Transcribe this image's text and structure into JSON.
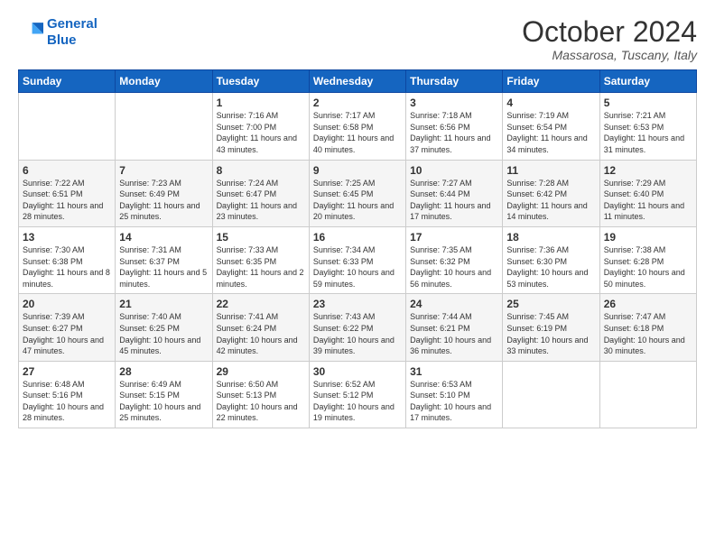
{
  "logo": {
    "line1": "General",
    "line2": "Blue"
  },
  "title": "October 2024",
  "location": "Massarosa, Tuscany, Italy",
  "weekdays": [
    "Sunday",
    "Monday",
    "Tuesday",
    "Wednesday",
    "Thursday",
    "Friday",
    "Saturday"
  ],
  "weeks": [
    [
      {
        "day": "",
        "info": ""
      },
      {
        "day": "",
        "info": ""
      },
      {
        "day": "1",
        "info": "Sunrise: 7:16 AM\nSunset: 7:00 PM\nDaylight: 11 hours and 43 minutes."
      },
      {
        "day": "2",
        "info": "Sunrise: 7:17 AM\nSunset: 6:58 PM\nDaylight: 11 hours and 40 minutes."
      },
      {
        "day": "3",
        "info": "Sunrise: 7:18 AM\nSunset: 6:56 PM\nDaylight: 11 hours and 37 minutes."
      },
      {
        "day": "4",
        "info": "Sunrise: 7:19 AM\nSunset: 6:54 PM\nDaylight: 11 hours and 34 minutes."
      },
      {
        "day": "5",
        "info": "Sunrise: 7:21 AM\nSunset: 6:53 PM\nDaylight: 11 hours and 31 minutes."
      }
    ],
    [
      {
        "day": "6",
        "info": "Sunrise: 7:22 AM\nSunset: 6:51 PM\nDaylight: 11 hours and 28 minutes."
      },
      {
        "day": "7",
        "info": "Sunrise: 7:23 AM\nSunset: 6:49 PM\nDaylight: 11 hours and 25 minutes."
      },
      {
        "day": "8",
        "info": "Sunrise: 7:24 AM\nSunset: 6:47 PM\nDaylight: 11 hours and 23 minutes."
      },
      {
        "day": "9",
        "info": "Sunrise: 7:25 AM\nSunset: 6:45 PM\nDaylight: 11 hours and 20 minutes."
      },
      {
        "day": "10",
        "info": "Sunrise: 7:27 AM\nSunset: 6:44 PM\nDaylight: 11 hours and 17 minutes."
      },
      {
        "day": "11",
        "info": "Sunrise: 7:28 AM\nSunset: 6:42 PM\nDaylight: 11 hours and 14 minutes."
      },
      {
        "day": "12",
        "info": "Sunrise: 7:29 AM\nSunset: 6:40 PM\nDaylight: 11 hours and 11 minutes."
      }
    ],
    [
      {
        "day": "13",
        "info": "Sunrise: 7:30 AM\nSunset: 6:38 PM\nDaylight: 11 hours and 8 minutes."
      },
      {
        "day": "14",
        "info": "Sunrise: 7:31 AM\nSunset: 6:37 PM\nDaylight: 11 hours and 5 minutes."
      },
      {
        "day": "15",
        "info": "Sunrise: 7:33 AM\nSunset: 6:35 PM\nDaylight: 11 hours and 2 minutes."
      },
      {
        "day": "16",
        "info": "Sunrise: 7:34 AM\nSunset: 6:33 PM\nDaylight: 10 hours and 59 minutes."
      },
      {
        "day": "17",
        "info": "Sunrise: 7:35 AM\nSunset: 6:32 PM\nDaylight: 10 hours and 56 minutes."
      },
      {
        "day": "18",
        "info": "Sunrise: 7:36 AM\nSunset: 6:30 PM\nDaylight: 10 hours and 53 minutes."
      },
      {
        "day": "19",
        "info": "Sunrise: 7:38 AM\nSunset: 6:28 PM\nDaylight: 10 hours and 50 minutes."
      }
    ],
    [
      {
        "day": "20",
        "info": "Sunrise: 7:39 AM\nSunset: 6:27 PM\nDaylight: 10 hours and 47 minutes."
      },
      {
        "day": "21",
        "info": "Sunrise: 7:40 AM\nSunset: 6:25 PM\nDaylight: 10 hours and 45 minutes."
      },
      {
        "day": "22",
        "info": "Sunrise: 7:41 AM\nSunset: 6:24 PM\nDaylight: 10 hours and 42 minutes."
      },
      {
        "day": "23",
        "info": "Sunrise: 7:43 AM\nSunset: 6:22 PM\nDaylight: 10 hours and 39 minutes."
      },
      {
        "day": "24",
        "info": "Sunrise: 7:44 AM\nSunset: 6:21 PM\nDaylight: 10 hours and 36 minutes."
      },
      {
        "day": "25",
        "info": "Sunrise: 7:45 AM\nSunset: 6:19 PM\nDaylight: 10 hours and 33 minutes."
      },
      {
        "day": "26",
        "info": "Sunrise: 7:47 AM\nSunset: 6:18 PM\nDaylight: 10 hours and 30 minutes."
      }
    ],
    [
      {
        "day": "27",
        "info": "Sunrise: 6:48 AM\nSunset: 5:16 PM\nDaylight: 10 hours and 28 minutes."
      },
      {
        "day": "28",
        "info": "Sunrise: 6:49 AM\nSunset: 5:15 PM\nDaylight: 10 hours and 25 minutes."
      },
      {
        "day": "29",
        "info": "Sunrise: 6:50 AM\nSunset: 5:13 PM\nDaylight: 10 hours and 22 minutes."
      },
      {
        "day": "30",
        "info": "Sunrise: 6:52 AM\nSunset: 5:12 PM\nDaylight: 10 hours and 19 minutes."
      },
      {
        "day": "31",
        "info": "Sunrise: 6:53 AM\nSunset: 5:10 PM\nDaylight: 10 hours and 17 minutes."
      },
      {
        "day": "",
        "info": ""
      },
      {
        "day": "",
        "info": ""
      }
    ]
  ]
}
